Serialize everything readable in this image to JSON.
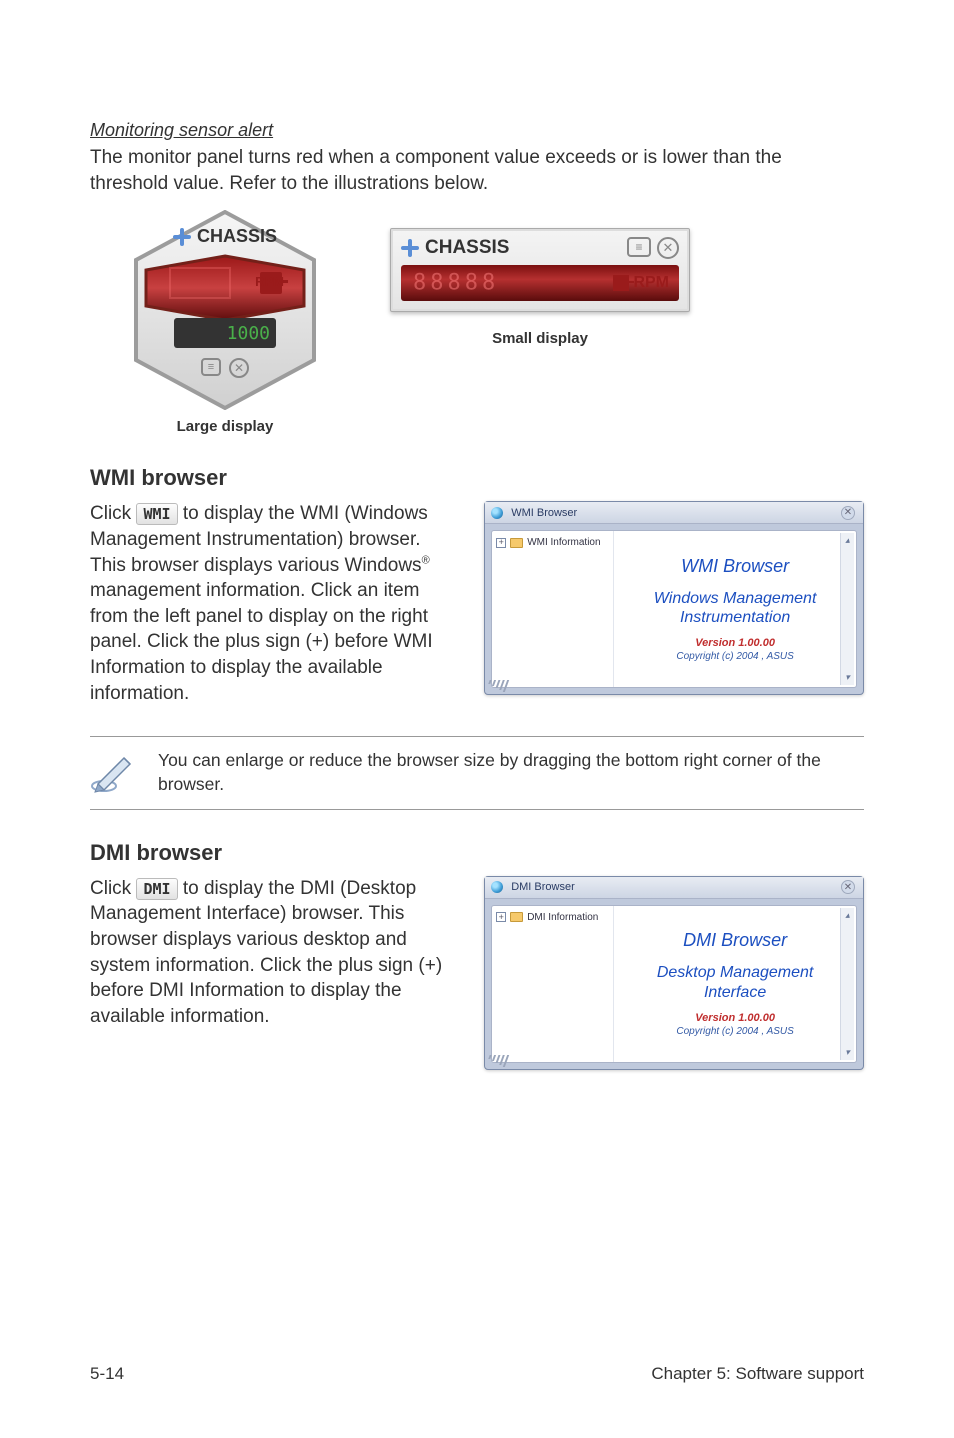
{
  "monitoring_alert": {
    "heading": "Monitoring sensor alert",
    "paragraph": "The monitor panel turns red when a component value exceeds or is lower than the threshold value. Refer to the illustrations below."
  },
  "large_display": {
    "chassis_label": "CHASSIS",
    "rpm_label": "RPM",
    "number": "1000",
    "caption": "Large display"
  },
  "small_display": {
    "chassis_label": "CHASSIS",
    "rpm_label": "RPM",
    "caption": "Small display"
  },
  "wmi": {
    "heading": "WMI browser",
    "button_label": "WMI",
    "paragraph_prefix": "Click ",
    "paragraph_part1": " to display the WMI (Windows Management Instrumentation) browser. This browser displays various Windows",
    "paragraph_part2": " management information. Click an item from the left panel to display on the right panel. Click the plus sign (+) before WMI Information to display the available information.",
    "window": {
      "title": "WMI Browser",
      "tree_label": "WMI Information",
      "big_title": "WMI  Browser",
      "mid_line1": "Windows Management",
      "mid_line2": "Instrumentation",
      "version": "Version 1.00.00",
      "copyright": "Copyright (c) 2004 , ASUS"
    }
  },
  "note": {
    "text": "You can enlarge or reduce the browser size by dragging the bottom right corner of the browser."
  },
  "dmi": {
    "heading": "DMI browser",
    "button_label": "DMI",
    "paragraph_prefix": "Click ",
    "paragraph_rest": " to display the DMI (Desktop Management Interface) browser. This browser displays various desktop and system information. Click the plus sign (+) before DMI Information to display the available information.",
    "window": {
      "title": "DMI Browser",
      "tree_label": "DMI Information",
      "big_title": "DMI  Browser",
      "mid_line1": "Desktop Management",
      "mid_line2": "Interface",
      "version": "Version 1.00.00",
      "copyright": "Copyright (c) 2004 , ASUS"
    }
  },
  "footer": {
    "left": "5-14",
    "right": "Chapter 5: Software support"
  }
}
